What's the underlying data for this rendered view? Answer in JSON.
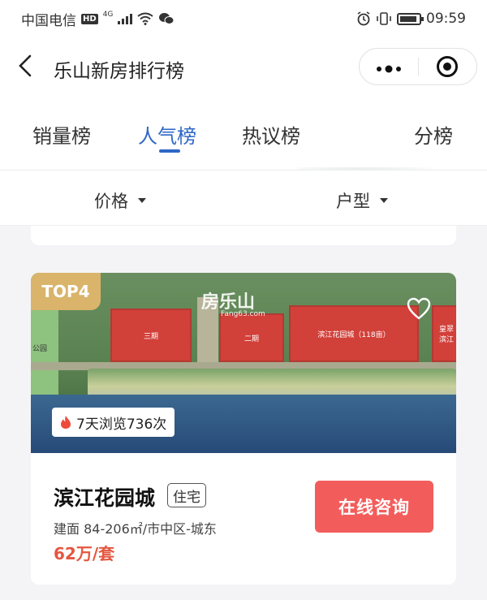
{
  "status_bar": {
    "carrier": "中国电信",
    "hd": "HD",
    "signal": "4G",
    "time": "09:59"
  },
  "header": {
    "title": "乐山新房排行榜",
    "back_icon": "chevron-left-icon",
    "menu_icon": "more-dots-icon",
    "close_icon": "target-circle-icon"
  },
  "tabs": [
    {
      "label": "销量榜",
      "active": false
    },
    {
      "label": "人气榜",
      "active": true
    },
    {
      "label": "热议榜",
      "active": false
    },
    {
      "label": "分榜",
      "active": false
    }
  ],
  "filters": [
    {
      "label": "价格"
    },
    {
      "label": "户型"
    }
  ],
  "listing": {
    "rank_badge": "TOP4",
    "photo_watermark": "房乐山",
    "photo_watermark_sub": "Fang63.com",
    "plot_labels": [
      "三期",
      "二期",
      "滨江花园城（118亩）",
      "皇翠",
      "滨江",
      "公园"
    ],
    "views": "7天浏览736次",
    "name": "滨江花园城",
    "type_tag": "住宅",
    "meta": "建面 84-206㎡/市中区-城东",
    "price": "62万/套",
    "consult_button": "在线咨询",
    "accent_color": "#f25d5b",
    "price_color": "#e5563f",
    "active_tab_color": "#2e67c6"
  }
}
